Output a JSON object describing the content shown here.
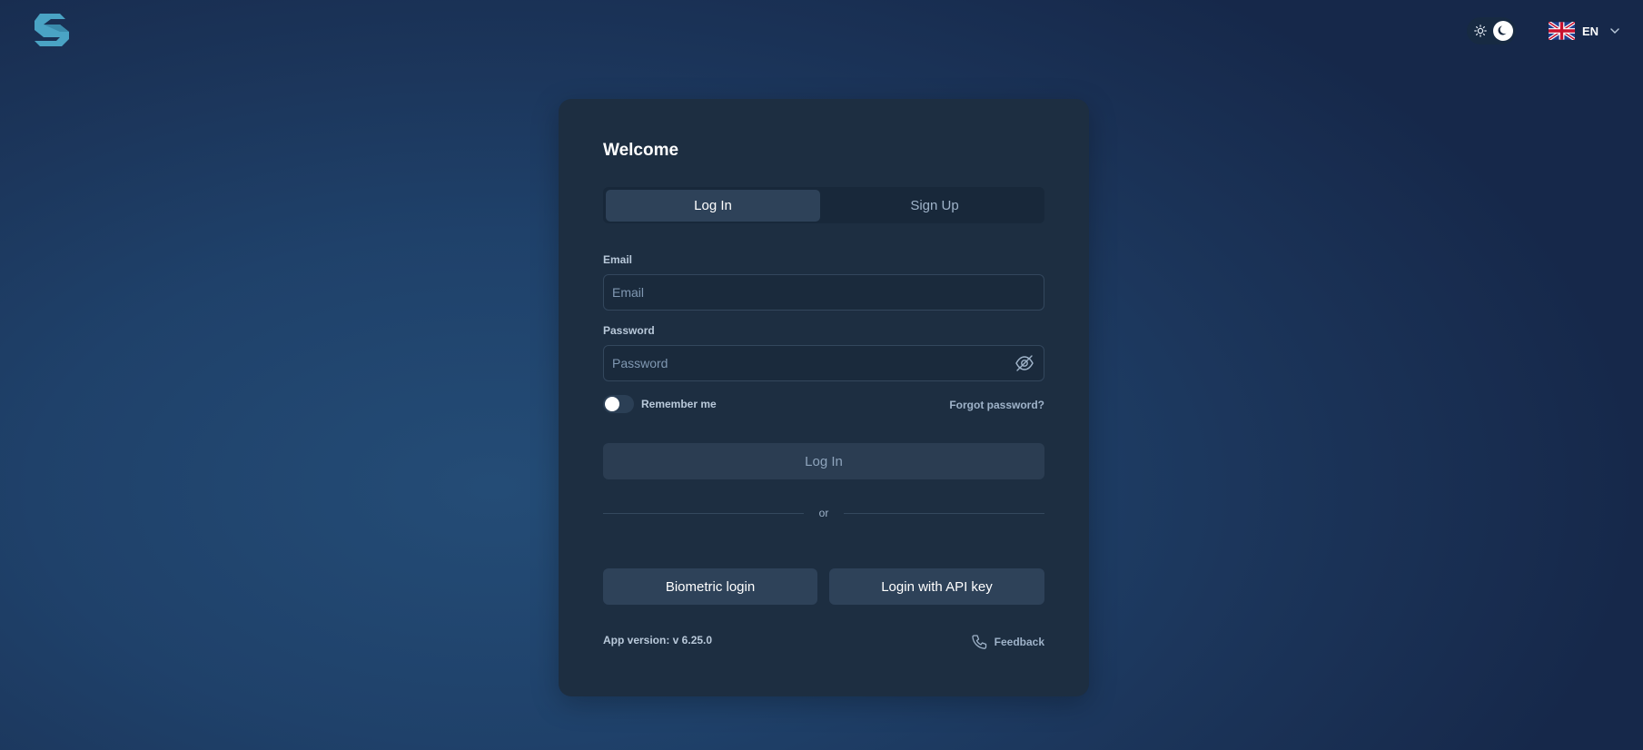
{
  "header": {
    "logo_icon": "s-logo-icon",
    "theme_toggle": {
      "light_icon": "sun-icon",
      "dark_icon": "moon-icon",
      "state": "dark"
    },
    "language": {
      "flag_icon": "uk-flag-icon",
      "code": "EN",
      "chevron_icon": "chevron-down-icon"
    }
  },
  "card": {
    "title": "Welcome",
    "tabs": [
      {
        "label": "Log In",
        "active": true
      },
      {
        "label": "Sign Up",
        "active": false
      }
    ],
    "email": {
      "label": "Email",
      "placeholder": "Email",
      "value": ""
    },
    "password": {
      "label": "Password",
      "placeholder": "Password",
      "value": "",
      "toggle_icon": "eye-off-icon"
    },
    "remember_me": {
      "label": "Remember me",
      "checked": false
    },
    "forgot_password": "Forgot password?",
    "login_button": "Log In",
    "divider_text": "or",
    "biometric_button": "Biometric login",
    "api_key_button": "Login with API key",
    "app_version": "App version: v 6.25.0",
    "feedback": {
      "label": "Feedback",
      "icon": "phone-icon"
    }
  },
  "colors": {
    "accent_logo": "#4aa3c4",
    "card_bg": "#1d2e41",
    "button_bg": "#2e4259"
  }
}
